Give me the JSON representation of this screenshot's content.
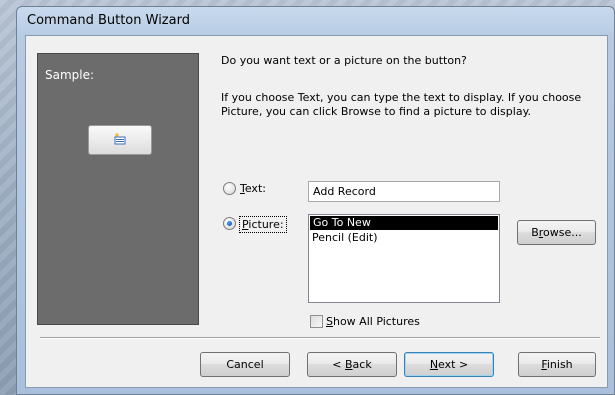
{
  "window": {
    "title": "Command Button Wizard"
  },
  "sample": {
    "label": "Sample:",
    "button_icon": "new-record-icon"
  },
  "question": "Do you want text or a picture on the button?",
  "description": "If you choose Text, you can type the text to display.  If you choose Picture, you can click Browse to find a picture to display.",
  "options": {
    "text_label": "Text:",
    "text_value": "Add Record",
    "picture_label": "Picture:",
    "selected": "picture"
  },
  "pictures": {
    "items": [
      "Go To New",
      "Pencil (Edit)"
    ],
    "selected_index": 0
  },
  "browse_label": "Browse...",
  "show_all_pictures": {
    "label": "Show All Pictures",
    "checked": false
  },
  "footer": {
    "cancel_label": "Cancel",
    "back_label": "< Back",
    "next_label": "Next >",
    "finish_label": "Finish"
  },
  "colors": {
    "sample_panel": "#6c6c6c",
    "selection": "#000000",
    "default_button_border": "#3c7fb1"
  }
}
